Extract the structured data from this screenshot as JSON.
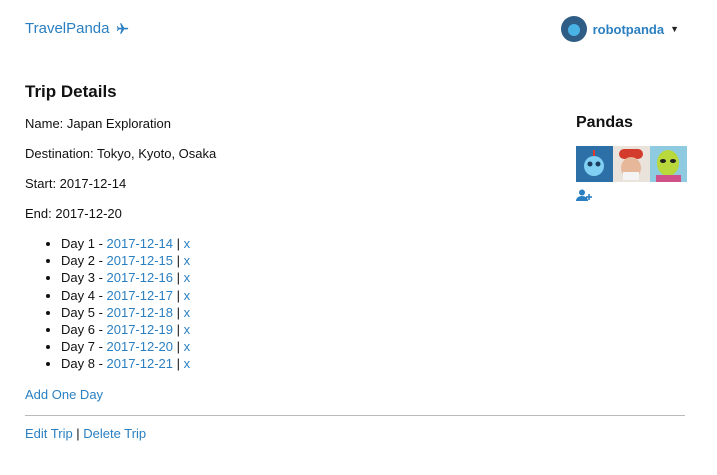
{
  "nav": {
    "brand": "TravelPanda",
    "username": "robotpanda"
  },
  "trip": {
    "heading": "Trip Details",
    "name": "Name: Japan Exploration",
    "destination": "Destination: Tokyo, Kyoto, Osaka",
    "start": "Start: 2017-12-14",
    "end": "End: 2017-12-20"
  },
  "days": [
    {
      "label": "Day 1 - ",
      "date": "2017-12-14",
      "sep": " | ",
      "remove": "x"
    },
    {
      "label": "Day 2 - ",
      "date": "2017-12-15",
      "sep": " | ",
      "remove": "x"
    },
    {
      "label": "Day 3 - ",
      "date": "2017-12-16",
      "sep": " | ",
      "remove": "x"
    },
    {
      "label": "Day 4 - ",
      "date": "2017-12-17",
      "sep": " | ",
      "remove": "x"
    },
    {
      "label": "Day 5 - ",
      "date": "2017-12-18",
      "sep": " | ",
      "remove": "x"
    },
    {
      "label": "Day 6 - ",
      "date": "2017-12-19",
      "sep": " | ",
      "remove": "x"
    },
    {
      "label": "Day 7 - ",
      "date": "2017-12-20",
      "sep": " | ",
      "remove": "x"
    },
    {
      "label": "Day 8 - ",
      "date": "2017-12-21",
      "sep": " | ",
      "remove": "x"
    }
  ],
  "actions": {
    "add_day": "Add One Day",
    "edit_trip": "Edit Trip",
    "separator": " | ",
    "delete_trip": "Delete Trip"
  },
  "pandas": {
    "heading": "Pandas",
    "members": [
      {
        "icon": "robot-panda-avatar",
        "bg": "#2d6fa7",
        "fg": "#7fd0f2"
      },
      {
        "icon": "man-red-hat-avatar",
        "bg": "#e9e3dc",
        "fg": "#d33b2c"
      },
      {
        "icon": "alien-avatar",
        "bg": "#8fcbe0",
        "fg": "#b8d83b"
      }
    ]
  },
  "colors": {
    "link": "#2a7fc1"
  }
}
